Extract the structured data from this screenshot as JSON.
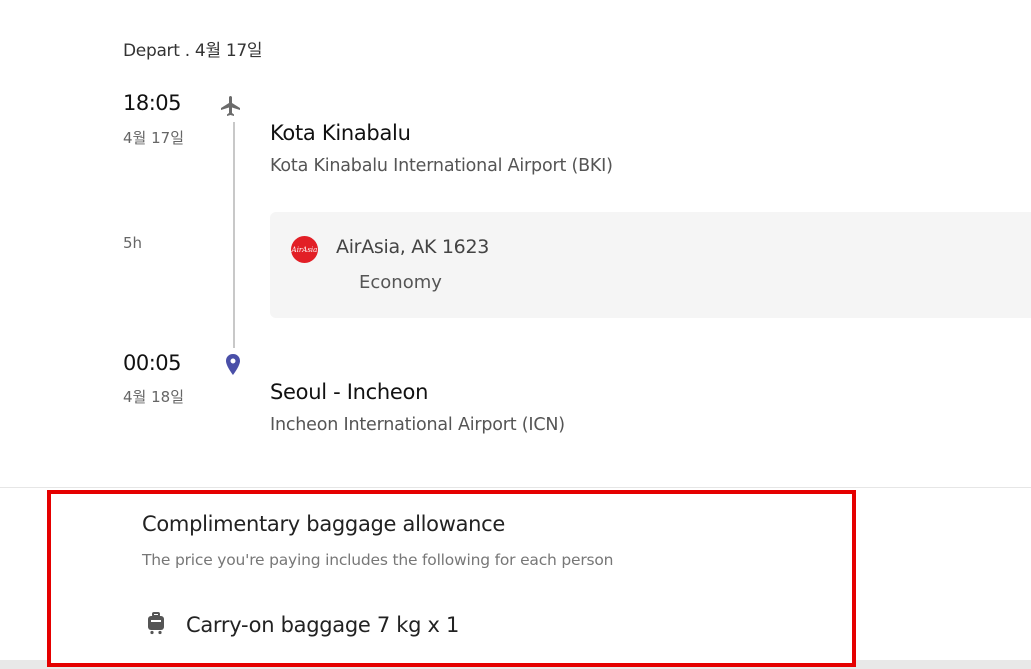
{
  "depart": {
    "label": "Depart . 4월 17일"
  },
  "segment": {
    "departure": {
      "time": "18:05",
      "date": "4월 17일",
      "city": "Kota Kinabalu",
      "airport": "Kota Kinabalu International Airport (BKI)"
    },
    "duration": "5h",
    "flight": {
      "airline_logo_text": "AirAsia",
      "airline": "AirAsia, AK 1623",
      "cabin": "Economy"
    },
    "arrival": {
      "time": "00:05",
      "date": "4월 18일",
      "city": "Seoul - Incheon",
      "airport": "Incheon International Airport (ICN)"
    }
  },
  "baggage": {
    "title": "Complimentary baggage allowance",
    "subtitle": "The price you're paying includes the following for each person",
    "item": "Carry-on baggage 7 kg x 1"
  },
  "colors": {
    "airasia_red": "#e21f26",
    "pin_blue": "#4a4fa8",
    "highlight": "#e50000"
  }
}
